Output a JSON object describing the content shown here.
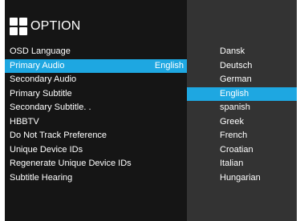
{
  "header": {
    "title": "OPTION",
    "icon": "grid-icon"
  },
  "menu": {
    "items": [
      {
        "label": "OSD Language",
        "value": ""
      },
      {
        "label": "Primary Audio",
        "value": "English"
      },
      {
        "label": "Secondary Audio",
        "value": ""
      },
      {
        "label": "Primary Subtitle",
        "value": ""
      },
      {
        "label": "Secondary Subtitle. .",
        "value": ""
      },
      {
        "label": "HBBTV",
        "value": ""
      },
      {
        "label": "Do Not Track Preference",
        "value": ""
      },
      {
        "label": "Unique Device IDs",
        "value": ""
      },
      {
        "label": "Regenerate Unique Device IDs",
        "value": ""
      },
      {
        "label": "Subtitle Hearing",
        "value": ""
      }
    ],
    "active_index": 1
  },
  "languages": {
    "items": [
      "Dansk",
      "Deutsch",
      "German",
      "English",
      "spanish",
      "Greek",
      "French",
      "Croatian",
      "Italian",
      "Hungarian"
    ],
    "selected_index": 3
  },
  "colors": {
    "highlight": "#1ea7e1",
    "background": "#151515",
    "submenu_background": "#333333",
    "text": "#ffffff"
  }
}
